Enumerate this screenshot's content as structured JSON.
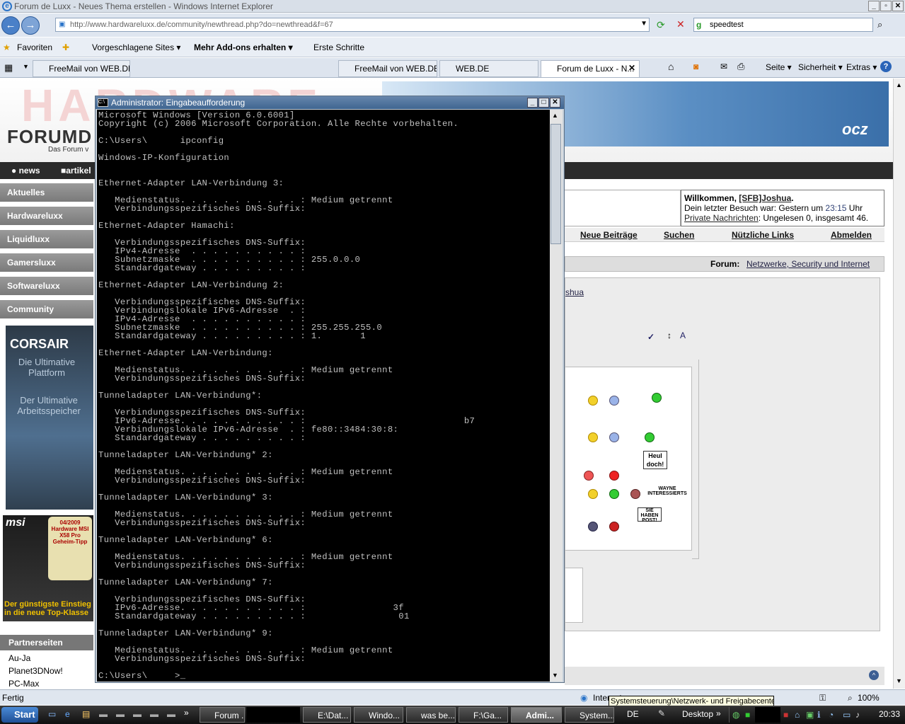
{
  "browser": {
    "window_title": "Forum de Luxx - Neues Thema erstellen - Windows Internet Explorer",
    "url": "http://www.hardwareluxx.de/community/newthread.php?do=newthread&f=67",
    "search_value": "speedtest",
    "favorites_label": "Favoriten",
    "fav_links": [
      "Vorgeschlagene Sites ▾",
      "Mehr Add-ons erhalten ▾",
      "Erste Schritte"
    ],
    "tabs": [
      "FreeMail von WEB.DE",
      "FreeMail von WEB.DE",
      "WEB.DE",
      "Forum de Luxx - N..."
    ],
    "command_bar": [
      "Seite ▾",
      "Sicherheit ▾",
      "Extras ▾"
    ],
    "status_text": "Fertig",
    "status_zone": "Internet",
    "zoom": "100%",
    "tooltip": "Systemsteuerung\\Netzwerk- und Freigabecenter"
  },
  "forum": {
    "logo_text": "FORUMD",
    "logo_sub": "Das Forum v",
    "brand": "ocz",
    "nav": [
      "news",
      "artikel"
    ],
    "sidebar": [
      "Aktuelles",
      "Hardwareluxx",
      "Liquidluxx",
      "Gamersluxx",
      "Softwareluxx",
      "Community"
    ],
    "ad_corsair": {
      "brand": "CORSAIR",
      "line1": "Die Ultimative Plattform",
      "line2": "Der Ultimative Arbeitsspeicher"
    },
    "ad_msi": {
      "brand": "msi",
      "badge": "04/2009 Hardware MSI X58 Pro Geheim-Tipp",
      "caption": "Der günstigste Einstieg in die neue Top-Klasse"
    },
    "partner_header": "Partnerseiten",
    "partner_links": [
      "Au-Ja",
      "Planet3DNow!",
      "PC-Max"
    ],
    "welcome_line1_prefix": "Willkommen, ",
    "welcome_user": "[SFB]Joshua",
    "welcome_line2_prefix": "Dein letzter Besuch war: Gestern um ",
    "welcome_time": "23:15",
    "welcome_line2_suffix": " Uhr",
    "welcome_pm_link": "Private Nachrichten",
    "welcome_pm_text": ": Ungelesen 0, insgesamt 46.",
    "links": [
      "Neue Beiträge",
      "Suchen",
      "Nützliche Links",
      "Abmelden"
    ],
    "forum_label": "Forum:",
    "forum_name": "Netzwerke, Security und Internet",
    "user_fragment": "shua",
    "smilie_labels": [
      "Heul doch!",
      "SIE HABEN POST!",
      "WAYNE INTERESSIERTS"
    ]
  },
  "cmd": {
    "title": "Administrator: Eingabeaufforderung",
    "lines": [
      "Microsoft Windows [Version 6.0.6001]",
      "Copyright (c) 2006 Microsoft Corporation. Alle Rechte vorbehalten.",
      "",
      "C:\\Users\\      ipconfig",
      "",
      "Windows-IP-Konfiguration",
      "",
      "",
      "Ethernet-Adapter LAN-Verbindung 3:",
      "",
      "   Medienstatus. . . . . . . . . . . : Medium getrennt",
      "   Verbindungsspezifisches DNS-Suffix:",
      "",
      "Ethernet-Adapter Hamachi:",
      "",
      "   Verbindungsspezifisches DNS-Suffix:",
      "   IPv4-Adresse  . . . . . . . . . . :",
      "   Subnetzmaske  . . . . . . . . . . : 255.0.0.0",
      "   Standardgateway . . . . . . . . . :",
      "",
      "Ethernet-Adapter LAN-Verbindung 2:",
      "",
      "   Verbindungsspezifisches DNS-Suffix:",
      "   Verbindungslokale IPv6-Adresse  . :",
      "   IPv4-Adresse  . . . . . . . . . . :",
      "   Subnetzmaske  . . . . . . . . . . : 255.255.255.0",
      "   Standardgateway . . . . . . . . . : 1.       1",
      "",
      "Ethernet-Adapter LAN-Verbindung:",
      "",
      "   Medienstatus. . . . . . . . . . . : Medium getrennt",
      "   Verbindungsspezifisches DNS-Suffix:",
      "",
      "Tunneladapter LAN-Verbindung*:",
      "",
      "   Verbindungsspezifisches DNS-Suffix:",
      "   IPv6-Adresse. . . . . . . . . . . :                             b7",
      "   Verbindungslokale IPv6-Adresse  . : fe80::3484:30:8:",
      "   Standardgateway . . . . . . . . . :",
      "",
      "Tunneladapter LAN-Verbindung* 2:",
      "",
      "   Medienstatus. . . . . . . . . . . : Medium getrennt",
      "   Verbindungsspezifisches DNS-Suffix:",
      "",
      "Tunneladapter LAN-Verbindung* 3:",
      "",
      "   Medienstatus. . . . . . . . . . . : Medium getrennt",
      "   Verbindungsspezifisches DNS-Suffix:",
      "",
      "Tunneladapter LAN-Verbindung* 6:",
      "",
      "   Medienstatus. . . . . . . . . . . : Medium getrennt",
      "   Verbindungsspezifisches DNS-Suffix:",
      "",
      "Tunneladapter LAN-Verbindung* 7:",
      "",
      "   Verbindungsspezifisches DNS-Suffix:",
      "   IPv6-Adresse. . . . . . . . . . . :                3f",
      "   Standardgateway . . . . . . . . . :                 01",
      "",
      "Tunneladapter LAN-Verbindung* 9:",
      "",
      "   Medienstatus. . . . . . . . . . . : Medium getrennt",
      "   Verbindungsspezifisches DNS-Suffix:",
      "",
      "C:\\Users\\     >_"
    ]
  },
  "taskbar": {
    "start": "Start",
    "tasks": [
      "Forum ...",
      "E:\\Dat...",
      "Windo...",
      "was be...",
      "F:\\Ga...",
      "Admi...",
      "System..."
    ],
    "lang": "DE",
    "desktop": "Desktop",
    "clock": "20:33"
  }
}
